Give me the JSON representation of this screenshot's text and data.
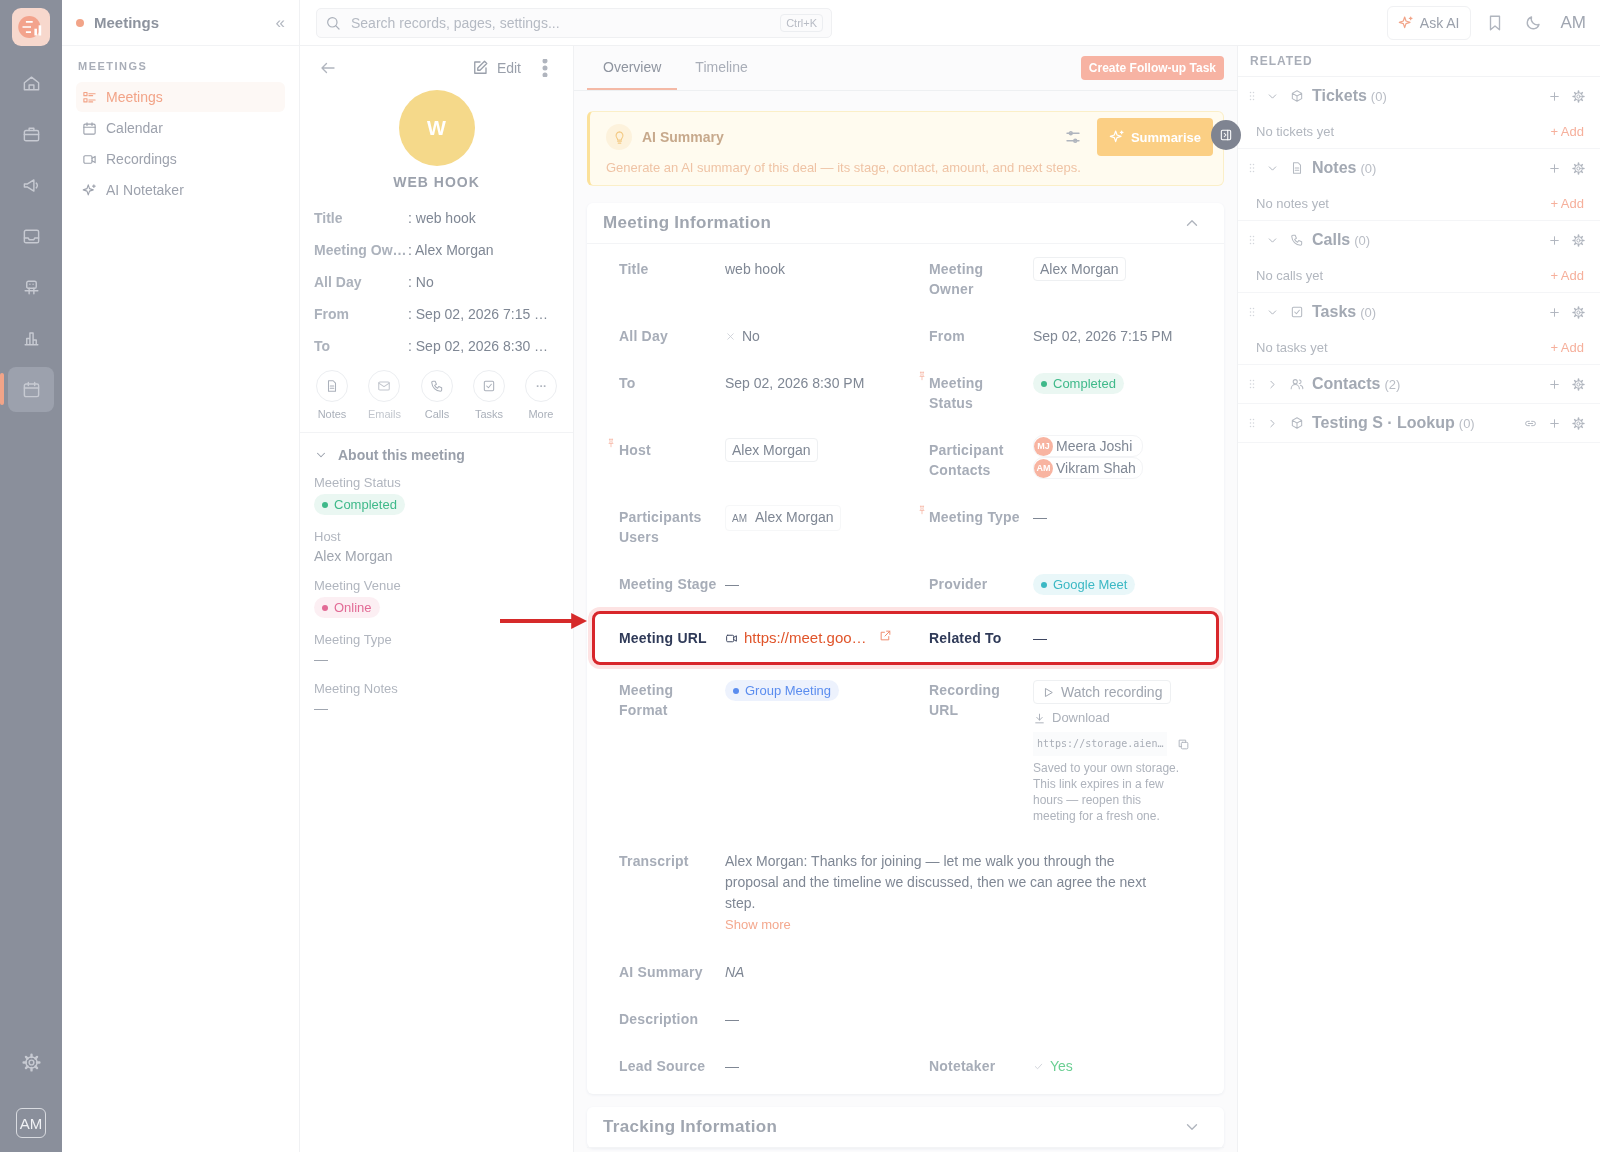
{
  "app": {
    "title": "Meetings",
    "collapse": "«"
  },
  "rail": {
    "items": [
      {
        "selected": false
      },
      {
        "selected": false
      },
      {
        "selected": false
      },
      {
        "selected": false
      },
      {
        "selected": false
      },
      {
        "selected": false
      },
      {
        "selected": true
      }
    ],
    "avatar": "AM"
  },
  "nav": {
    "section": "MEETINGS",
    "items": [
      {
        "label": "Meetings",
        "selected": true
      },
      {
        "label": "Calendar",
        "selected": false
      },
      {
        "label": "Recordings",
        "selected": false
      },
      {
        "label": "AI Notetaker",
        "selected": false
      }
    ]
  },
  "search": {
    "placeholder": "Search records, pages, settings...",
    "shortcut": "Ctrl+K"
  },
  "topbar": {
    "ask_ai": "Ask AI",
    "avatar": "AM"
  },
  "record": {
    "edit": "Edit",
    "initial": "W",
    "name": "WEB HOOK",
    "fields": [
      {
        "label": "Title",
        "value": ": web hook"
      },
      {
        "label": "Meeting Ow…",
        "value": ": Alex Morgan"
      },
      {
        "label": "All Day",
        "value": ": No"
      },
      {
        "label": "From",
        "value": ": Sep 02, 2026 7:15 …"
      },
      {
        "label": "To",
        "value": ": Sep 02, 2026 8:30 …"
      }
    ],
    "actions": [
      {
        "label": "Notes",
        "disabled": false
      },
      {
        "label": "Emails",
        "disabled": true
      },
      {
        "label": "Calls",
        "disabled": false
      },
      {
        "label": "Tasks",
        "disabled": false
      },
      {
        "label": "More",
        "disabled": false
      }
    ],
    "about": {
      "title": "About this meeting",
      "expanded": true,
      "fields": [
        {
          "label": "Meeting Status",
          "kind": "badge",
          "value": "Completed",
          "color": "#3fb98a"
        },
        {
          "label": "Host",
          "kind": "text",
          "value": "Alex Morgan"
        },
        {
          "label": "Meeting Venue",
          "kind": "badge",
          "value": "Online",
          "color": "#e26b96"
        },
        {
          "label": "Meeting Type",
          "kind": "text",
          "value": "—"
        },
        {
          "label": "Meeting Notes",
          "kind": "text",
          "value": "—"
        }
      ]
    }
  },
  "tabs": [
    {
      "label": "Overview",
      "selected": true
    },
    {
      "label": "Timeline",
      "selected": false
    }
  ],
  "follow_up_button": "Create Follow-up Task",
  "ai_summary": {
    "title": "AI Summary",
    "button": "Summarise",
    "description": "Generate an AI summary of this deal — its stage, contact, amount, and next steps."
  },
  "meeting_info": {
    "title": "Meeting Information",
    "expanded": true,
    "rows": [
      {
        "highlighted": false,
        "cells": [
          {
            "label": "Title",
            "kind": "text",
            "value": "web hook",
            "required": false
          },
          {
            "label": "Meeting Owner",
            "kind": "chip",
            "value": "Alex Morgan",
            "required": false
          }
        ]
      },
      {
        "highlighted": false,
        "cells": [
          {
            "label": "All Day",
            "kind": "cross",
            "value": "No",
            "required": false
          },
          {
            "label": "From",
            "kind": "text",
            "value": "Sep 02, 2026 7:15 PM",
            "required": false
          }
        ]
      },
      {
        "highlighted": false,
        "cells": [
          {
            "label": "To",
            "kind": "text",
            "value": "Sep 02, 2026 8:30 PM",
            "required": false
          },
          {
            "label": "Meeting Status",
            "kind": "badge",
            "value": "Completed",
            "color": "#3fb98a",
            "required": true
          }
        ]
      },
      {
        "highlighted": false,
        "cells": [
          {
            "label": "Host",
            "kind": "chip",
            "value": "Alex Morgan",
            "required": true
          },
          {
            "label": "Participant Contacts",
            "kind": "contacts",
            "required": false,
            "contacts": [
              {
                "initials": "MJ",
                "name": "Meera Joshi"
              },
              {
                "initials": "AM",
                "name": "Vikram Shah"
              }
            ]
          }
        ]
      },
      {
        "highlighted": false,
        "cells": [
          {
            "label": "Participants Users",
            "kind": "user",
            "initials": "AM",
            "value": "Alex Morgan",
            "required": false
          },
          {
            "label": "Meeting Type",
            "kind": "text",
            "value": "—",
            "required": true
          }
        ]
      },
      {
        "highlighted": false,
        "cells": [
          {
            "label": "Meeting Stage",
            "kind": "text",
            "value": "—",
            "required": false
          },
          {
            "label": "Provider",
            "kind": "badge",
            "value": "Google Meet",
            "color": "#3bb8c4",
            "required": false
          }
        ]
      },
      {
        "highlighted": true,
        "cells": [
          {
            "label": "Meeting URL",
            "kind": "link",
            "value": "https://meet.goo…",
            "required": false
          },
          {
            "label": "Related To",
            "kind": "text",
            "value": "—",
            "required": false
          }
        ]
      },
      {
        "highlighted": false,
        "cells": [
          {
            "label": "Meeting Format",
            "kind": "badge",
            "value": "Group Meeting",
            "color": "#5b8def",
            "required": false
          },
          {
            "label": "Recording URL",
            "kind": "recording",
            "required": false,
            "watch": "Watch recording",
            "download": "Download",
            "url": "https://storage.aien…",
            "note": "Saved to your own storage. This link expires in a few hours — reopen this meeting for a fresh one."
          }
        ]
      },
      {
        "highlighted": false,
        "cells": [
          {
            "label": "Transcript",
            "kind": "longtext",
            "value": "Alex Morgan: Thanks for joining — let me walk you through the proposal and the timeline we discussed, then we can agree the next step.",
            "show_more": "Show more",
            "required": false
          }
        ]
      },
      {
        "highlighted": false,
        "cells": [
          {
            "label": "AI Summary",
            "kind": "italic",
            "value": "NA",
            "required": false
          }
        ]
      },
      {
        "highlighted": false,
        "cells": [
          {
            "label": "Description",
            "kind": "text",
            "value": "—",
            "required": false
          }
        ]
      },
      {
        "highlighted": false,
        "cells": [
          {
            "label": "Lead Source",
            "kind": "text",
            "value": "—",
            "required": false
          },
          {
            "label": "Notetaker",
            "kind": "check",
            "value": "Yes",
            "required": false
          }
        ]
      }
    ]
  },
  "tracking": {
    "title": "Tracking Information",
    "expanded": false
  },
  "related": {
    "title": "RELATED",
    "sections": [
      {
        "title": "Tickets",
        "count": "(0)",
        "expanded": true,
        "link": false,
        "empty": "No tickets yet",
        "add": "+ Add"
      },
      {
        "title": "Notes",
        "count": "(0)",
        "expanded": true,
        "link": false,
        "empty": "No notes yet",
        "add": "+ Add"
      },
      {
        "title": "Calls",
        "count": "(0)",
        "expanded": true,
        "link": false,
        "empty": "No calls yet",
        "add": "+ Add"
      },
      {
        "title": "Tasks",
        "count": "(0)",
        "expanded": true,
        "link": false,
        "empty": "No tasks yet",
        "add": "+ Add"
      },
      {
        "title": "Contacts",
        "count": "(2)",
        "expanded": false,
        "link": false
      },
      {
        "title": "Testing S · Lookup",
        "count": "(0)",
        "expanded": false,
        "link": true
      }
    ]
  }
}
